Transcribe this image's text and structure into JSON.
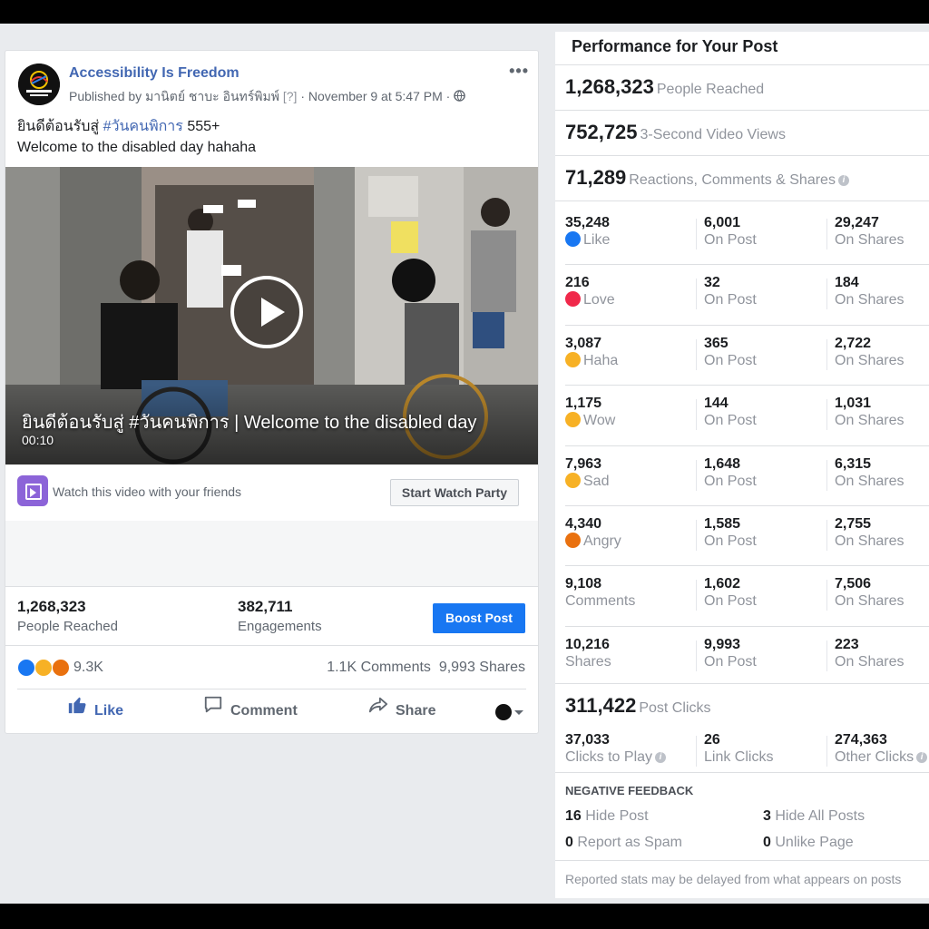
{
  "post": {
    "page_name": "Accessibility Is Freedom",
    "published_prefix": "Published by",
    "publisher": "มานิตย์ ชาบะ อินทร์พิมพ์",
    "help_marker": "[?]",
    "timestamp": "November 9 at 5:47 PM",
    "caption_line1_text": "ยินดีต้อนรับสู่ ",
    "caption_hashtag": "#วันคนพิการ",
    "caption_line1_suffix": " 555+",
    "caption_line2": "Welcome to the disabled day hahaha",
    "video": {
      "title": "ยินดีต้อนรับสู่ #วันคนพิการ | Welcome to the disabled day",
      "duration": "00:10"
    },
    "watch_party": {
      "prompt": "Watch this video with your friends",
      "button": "Start Watch Party"
    },
    "insights": {
      "reached_value": "1,268,323",
      "reached_label": "People Reached",
      "engagements_value": "382,711",
      "engagements_label": "Engagements",
      "boost_button": "Boost Post"
    },
    "reactions_count": "9.3K",
    "comments_count": "1.1K Comments",
    "shares_count": "9,993 Shares",
    "actions": {
      "like": "Like",
      "comment": "Comment",
      "share": "Share"
    }
  },
  "panel": {
    "title": "Performance for Your Post",
    "people_reached": {
      "value": "1,268,323",
      "label": "People Reached"
    },
    "video_views": {
      "value": "752,725",
      "label": "3-Second Video Views"
    },
    "engagement": {
      "value": "71,289",
      "label": "Reactions, Comments & Shares"
    },
    "rows": [
      {
        "total": "35,248",
        "label": "Like",
        "emoji": "like",
        "on_post": "6,001",
        "on_post_label": "On Post",
        "on_shares": "29,247",
        "on_shares_label": "On Shares"
      },
      {
        "total": "216",
        "label": "Love",
        "emoji": "love",
        "on_post": "32",
        "on_post_label": "On Post",
        "on_shares": "184",
        "on_shares_label": "On Shares"
      },
      {
        "total": "3,087",
        "label": "Haha",
        "emoji": "haha",
        "on_post": "365",
        "on_post_label": "On Post",
        "on_shares": "2,722",
        "on_shares_label": "On Shares"
      },
      {
        "total": "1,175",
        "label": "Wow",
        "emoji": "wow",
        "on_post": "144",
        "on_post_label": "On Post",
        "on_shares": "1,031",
        "on_shares_label": "On Shares"
      },
      {
        "total": "7,963",
        "label": "Sad",
        "emoji": "sad",
        "on_post": "1,648",
        "on_post_label": "On Post",
        "on_shares": "6,315",
        "on_shares_label": "On Shares"
      },
      {
        "total": "4,340",
        "label": "Angry",
        "emoji": "angry",
        "on_post": "1,585",
        "on_post_label": "On Post",
        "on_shares": "2,755",
        "on_shares_label": "On Shares"
      },
      {
        "total": "9,108",
        "label": "Comments",
        "emoji": "",
        "on_post": "1,602",
        "on_post_label": "On Post",
        "on_shares": "7,506",
        "on_shares_label": "On Shares"
      },
      {
        "total": "10,216",
        "label": "Shares",
        "emoji": "",
        "on_post": "9,993",
        "on_post_label": "On Post",
        "on_shares": "223",
        "on_shares_label": "On Shares"
      }
    ],
    "post_clicks": {
      "value": "311,422",
      "label": "Post Clicks"
    },
    "clicks": [
      {
        "value": "37,033",
        "label": "Clicks to Play"
      },
      {
        "value": "26",
        "label": "Link Clicks"
      },
      {
        "value": "274,363",
        "label": "Other Clicks"
      }
    ],
    "negative": {
      "heading": "NEGATIVE FEEDBACK",
      "hide_post_value": "16",
      "hide_post_label": "Hide Post",
      "hide_all_value": "3",
      "hide_all_label": "Hide All Posts",
      "spam_value": "0",
      "spam_label": "Report as Spam",
      "unlike_value": "0",
      "unlike_label": "Unlike Page"
    },
    "footnote": "Reported stats may be delayed from what appears on posts"
  },
  "colors": {
    "link_blue": "#4267b2",
    "boost_blue": "#1877f2",
    "watch_party_purple": "#8c64d8",
    "like": "#1877f2",
    "love": "#f0284a",
    "haha": "#f7b125",
    "wow": "#f7b125",
    "sad": "#f7b125",
    "angry": "#e9710f"
  }
}
